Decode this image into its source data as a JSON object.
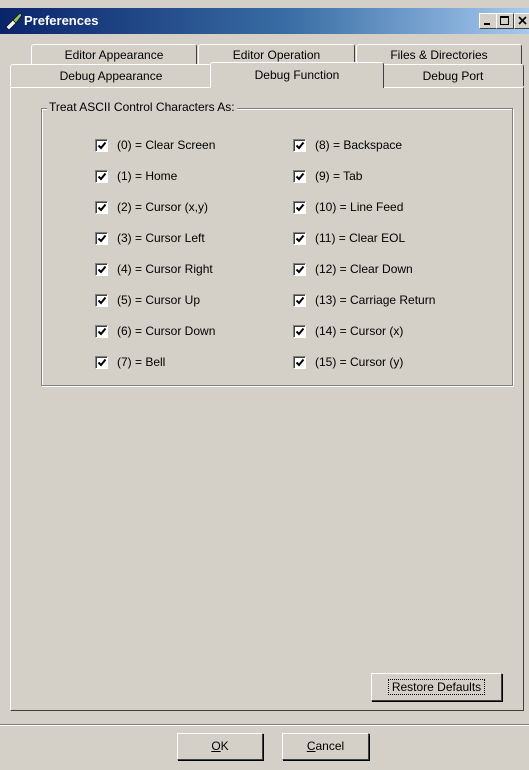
{
  "window": {
    "title": "Preferences"
  },
  "tabs": {
    "row1": [
      "Editor Appearance",
      "Editor Operation",
      "Files & Directories"
    ],
    "row2": [
      "Debug Appearance",
      "Debug Function",
      "Debug Port"
    ],
    "active": "Debug Function"
  },
  "group": {
    "label": "Treat ASCII Control Characters As:",
    "left_items": [
      {
        "label": "(0) = Clear Screen",
        "checked": true
      },
      {
        "label": "(1) = Home",
        "checked": true
      },
      {
        "label": "(2) = Cursor (x,y)",
        "checked": true
      },
      {
        "label": "(3) = Cursor Left",
        "checked": true
      },
      {
        "label": "(4) = Cursor Right",
        "checked": true
      },
      {
        "label": "(5) = Cursor Up",
        "checked": true
      },
      {
        "label": "(6) = Cursor Down",
        "checked": true
      },
      {
        "label": "(7) = Bell",
        "checked": true
      }
    ],
    "right_items": [
      {
        "label": "(8) = Backspace",
        "checked": true
      },
      {
        "label": "(9) = Tab",
        "checked": true
      },
      {
        "label": "(10) = Line Feed",
        "checked": true
      },
      {
        "label": "(11) = Clear EOL",
        "checked": true
      },
      {
        "label": "(12) = Clear Down",
        "checked": true
      },
      {
        "label": "(13) = Carriage Return",
        "checked": true
      },
      {
        "label": "(14) = Cursor (x)",
        "checked": true
      },
      {
        "label": "(15) = Cursor (y)",
        "checked": true
      }
    ]
  },
  "buttons": {
    "restore_defaults": "Restore Defaults",
    "ok_hotkey": "O",
    "ok_rest": "K",
    "cancel_hotkey": "C",
    "cancel_rest": "ancel"
  }
}
